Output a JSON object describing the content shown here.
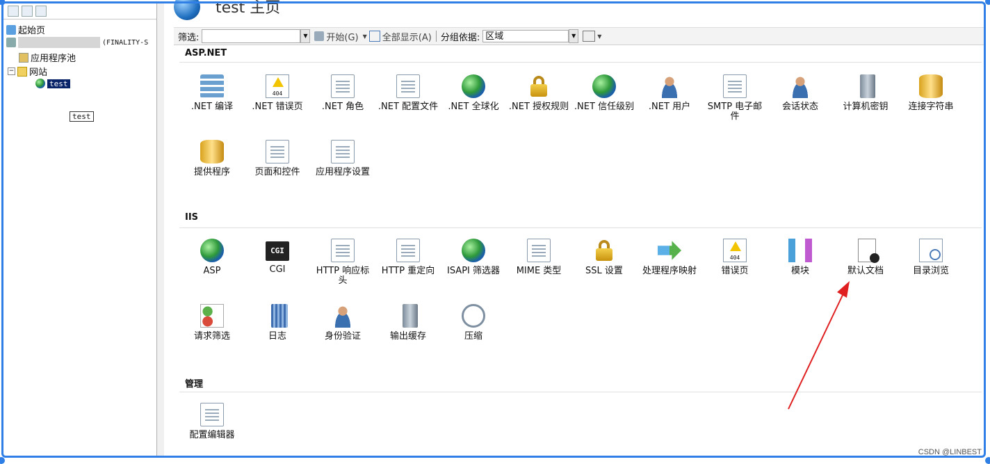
{
  "colors": {
    "frame": "#2f7fe6",
    "selection": "#0a246a",
    "annotation_arrow": "#e02020"
  },
  "tree": {
    "start_page": "起始页",
    "server_suffix": "(FINALITY-S",
    "app_pools": "应用程序池",
    "sites": "网站",
    "site_test": "test",
    "tooltip": "test"
  },
  "header": {
    "title": "test 主页"
  },
  "filterbar": {
    "filter_label": "筛选:",
    "start_label": "开始(G)",
    "show_all_label": "全部显示(A)",
    "group_label": "分组依据:",
    "group_value": "区域"
  },
  "sections": {
    "aspnet": {
      "title": "ASP.NET",
      "items": [
        {
          "label": ".NET 编译",
          "icon": "compile-icon"
        },
        {
          "label": ".NET 错误页",
          "icon": "error-page-icon"
        },
        {
          "label": ".NET 角色",
          "icon": "roles-icon"
        },
        {
          "label": ".NET 配置文件",
          "icon": "profile-icon"
        },
        {
          "label": ".NET 全球化",
          "icon": "globe-icon"
        },
        {
          "label": ".NET 授权规则",
          "icon": "authorization-icon"
        },
        {
          "label": ".NET 信任级别",
          "icon": "trust-level-icon"
        },
        {
          "label": ".NET 用户",
          "icon": "users-icon"
        },
        {
          "label": "SMTP 电子邮件",
          "icon": "smtp-icon"
        },
        {
          "label": "会话状态",
          "icon": "session-icon"
        },
        {
          "label": "计算机密钥",
          "icon": "machine-key-icon"
        },
        {
          "label": "连接字符串",
          "icon": "connection-string-icon"
        },
        {
          "label": "提供程序",
          "icon": "providers-icon"
        },
        {
          "label": "页面和控件",
          "icon": "pages-controls-icon"
        },
        {
          "label": "应用程序设置",
          "icon": "app-settings-icon"
        }
      ]
    },
    "iis": {
      "title": "IIS",
      "items": [
        {
          "label": "ASP",
          "icon": "asp-icon"
        },
        {
          "label": "CGI",
          "icon": "cgi-icon"
        },
        {
          "label": "HTTP 响应标头",
          "icon": "http-headers-icon"
        },
        {
          "label": "HTTP 重定向",
          "icon": "http-redirect-icon"
        },
        {
          "label": "ISAPI 筛选器",
          "icon": "isapi-filter-icon"
        },
        {
          "label": "MIME 类型",
          "icon": "mime-icon"
        },
        {
          "label": "SSL 设置",
          "icon": "ssl-lock-icon"
        },
        {
          "label": "处理程序映射",
          "icon": "handler-mappings-icon"
        },
        {
          "label": "错误页",
          "icon": "error-page-icon"
        },
        {
          "label": "模块",
          "icon": "modules-icon"
        },
        {
          "label": "默认文档",
          "icon": "default-document-icon"
        },
        {
          "label": "目录浏览",
          "icon": "directory-browsing-icon"
        },
        {
          "label": "请求筛选",
          "icon": "request-filtering-icon"
        },
        {
          "label": "日志",
          "icon": "logging-icon"
        },
        {
          "label": "身份验证",
          "icon": "authentication-icon"
        },
        {
          "label": "输出缓存",
          "icon": "output-cache-icon"
        },
        {
          "label": "压缩",
          "icon": "compression-icon"
        }
      ]
    },
    "management": {
      "title": "管理",
      "items": [
        {
          "label": "配置编辑器",
          "icon": "config-editor-icon"
        }
      ]
    }
  },
  "watermark": "CSDN @LINBEST"
}
